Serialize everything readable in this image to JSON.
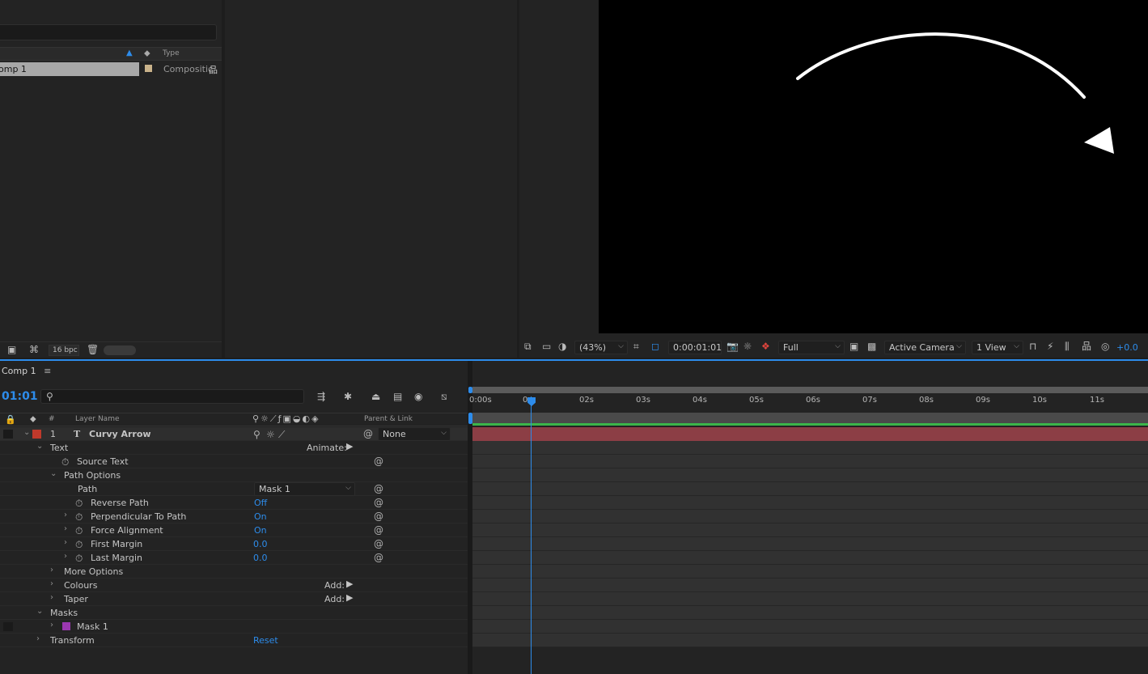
{
  "project": {
    "header_type": "Type",
    "item_name": "omp 1",
    "item_type": "Compositic",
    "bpc": "16 bpc"
  },
  "viewer": {
    "zoom": "(43%)",
    "timecode": "0:00:01:01",
    "resolution": "Full",
    "camera": "Active Camera",
    "views": "1 View",
    "exposure": "+0.0"
  },
  "timeline": {
    "tab": "Comp 1",
    "time": "01:01",
    "headers": {
      "number": "#",
      "layer_name": "Layer Name",
      "parent": "Parent & Link"
    },
    "ruler": [
      "0:00s",
      "0",
      "02s",
      "03s",
      "04s",
      "05s",
      "06s",
      "07s",
      "08s",
      "09s",
      "10s",
      "11s"
    ],
    "layer": {
      "index": "1",
      "name": "Curvy Arrow",
      "parent": "None",
      "label_color": "#c0392b"
    },
    "props": {
      "text": "Text",
      "animate": "Animate:",
      "source_text": "Source Text",
      "path_options": "Path Options",
      "path": "Path",
      "path_value": "Mask 1",
      "reverse_path": "Reverse Path",
      "reverse_path_value": "Off",
      "perpendicular": "Perpendicular To Path",
      "perpendicular_value": "On",
      "force_alignment": "Force Alignment",
      "force_alignment_value": "On",
      "first_margin": "First Margin",
      "first_margin_value": "0.0",
      "last_margin": "Last Margin",
      "last_margin_value": "0.0",
      "more_options": "More Options",
      "colours": "Colours",
      "taper": "Taper",
      "add": "Add:",
      "masks": "Masks",
      "mask1": "Mask 1",
      "transform": "Transform",
      "reset": "Reset"
    }
  }
}
